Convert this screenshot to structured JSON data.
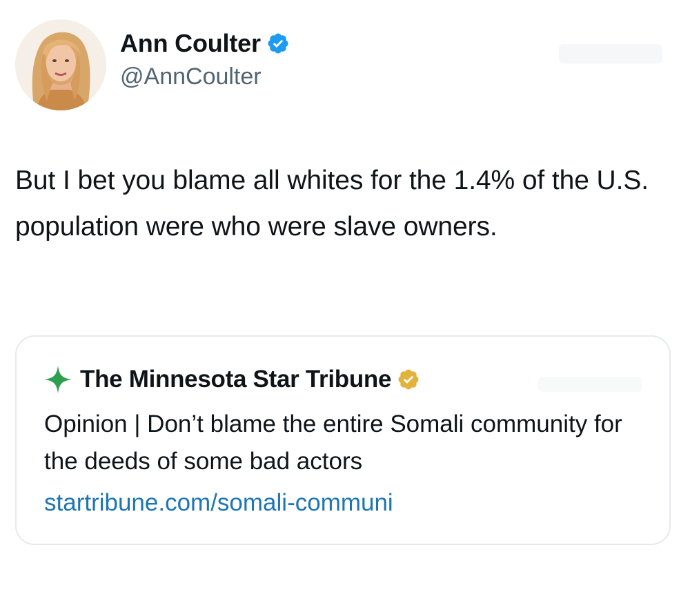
{
  "author": {
    "name": "Ann Coulter",
    "handle": "@AnnCoulter",
    "avatar_icon": "profile-photo",
    "verified_icon": "blue-verified-badge",
    "verified_color": "#1d9bf0"
  },
  "tweet": {
    "text": "But I bet you blame all whites for the 1.4% of the U.S. population were who were slave owners."
  },
  "quoted": {
    "source_name": "The Minnesota Star Tribune",
    "logo_icon": "green-star-icon",
    "logo_color": "#2e9e4f",
    "verified_icon": "gold-verified-badge",
    "verified_color": "#e2b33b",
    "text": "Opinion | Don’t blame the entire Somali community for the deeds of some bad actors",
    "link": "startribune.com/somali-communi",
    "link_color": "#1d75b3"
  }
}
